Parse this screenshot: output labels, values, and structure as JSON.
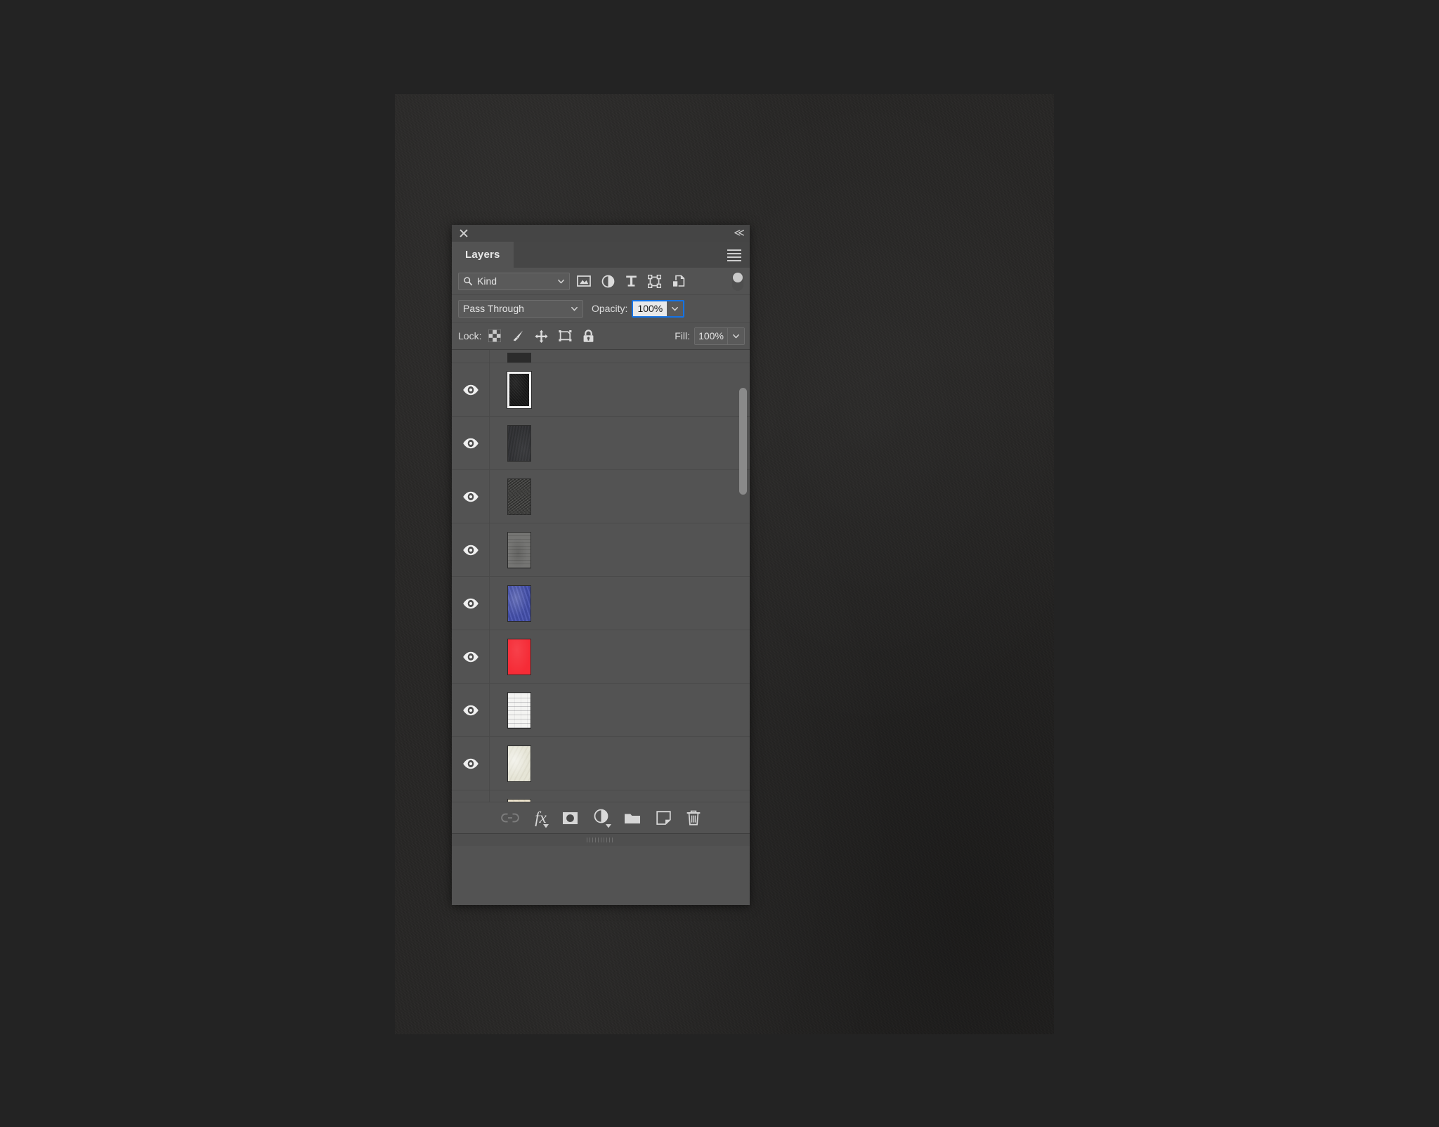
{
  "window": {
    "close_label": "×",
    "collapse_label": "«"
  },
  "panel": {
    "tab_label": "Layers",
    "menu_icon": "hamburger-menu-icon"
  },
  "filter_row": {
    "kind_label": "Kind",
    "search_icon": "search-icon",
    "dropdown_icon": "chevron-down-icon",
    "type_filters": [
      {
        "name": "filter-pixel-layers",
        "icon": "image-icon"
      },
      {
        "name": "filter-adjustment-layers",
        "icon": "adjustment-half-circle-icon"
      },
      {
        "name": "filter-type-layers",
        "icon": "text-t-icon"
      },
      {
        "name": "filter-shape-layers",
        "icon": "shape-vector-icon"
      },
      {
        "name": "filter-smart-objects",
        "icon": "smart-object-icon"
      }
    ],
    "toggle_name": "filter-enable-toggle"
  },
  "blend_row": {
    "blend_mode": "Pass Through",
    "opacity_label": "Opacity:",
    "opacity_value": "100%",
    "opacity_focused": true,
    "focus_color": "#1473e6"
  },
  "lock_row": {
    "lock_label": "Lock:",
    "lock_buttons": [
      {
        "name": "lock-transparent-pixels",
        "icon": "checkerboard-icon"
      },
      {
        "name": "lock-image-pixels",
        "icon": "brush-icon"
      },
      {
        "name": "lock-position",
        "icon": "move-arrows-icon"
      },
      {
        "name": "lock-artboard-nesting",
        "icon": "artboard-icon"
      },
      {
        "name": "lock-all",
        "icon": "padlock-icon"
      }
    ],
    "fill_label": "Fill:",
    "fill_value": "100%"
  },
  "layers": [
    {
      "name": "",
      "visible": false,
      "partial": true,
      "selected": false,
      "thumb": "dark-strip"
    },
    {
      "name": "",
      "visible": true,
      "partial": false,
      "selected": true,
      "thumb": "black-textured"
    },
    {
      "name": "",
      "visible": true,
      "partial": false,
      "selected": false,
      "thumb": "dark-charcoal"
    },
    {
      "name": "",
      "visible": true,
      "partial": false,
      "selected": false,
      "thumb": "dark-grunge"
    },
    {
      "name": "",
      "visible": true,
      "partial": false,
      "selected": false,
      "thumb": "gray-sketch"
    },
    {
      "name": "",
      "visible": true,
      "partial": false,
      "selected": false,
      "thumb": "blue-fabric"
    },
    {
      "name": "",
      "visible": true,
      "partial": false,
      "selected": false,
      "thumb": "red-solid"
    },
    {
      "name": "",
      "visible": true,
      "partial": false,
      "selected": false,
      "thumb": "white-paper-lines"
    },
    {
      "name": "",
      "visible": true,
      "partial": false,
      "selected": false,
      "thumb": "cream-paper"
    },
    {
      "name": "",
      "visible": true,
      "partial": false,
      "selected": false,
      "thumb": "aged-paper"
    }
  ],
  "thumb_colors": {
    "dark-strip": "#2b2b2b",
    "black-textured": "#191919",
    "dark-charcoal": "#2f3033",
    "dark-grunge": "#3a3a38",
    "gray-sketch": "#6e6e6c",
    "blue-fabric": "#4450ad",
    "red-solid": "#f62b36",
    "white-paper-lines": "#f4f4f2",
    "cream-paper": "#e6e5d7",
    "aged-paper": "#ece3cd"
  },
  "scrollbar": {
    "name": "layer-list-scrollbar"
  },
  "footer": {
    "buttons": [
      {
        "name": "link-layers-button",
        "icon": "chain-link-icon",
        "disabled": true,
        "label": ""
      },
      {
        "name": "layer-style-button",
        "icon": "fx-icon",
        "label": "fx",
        "has_menu": true
      },
      {
        "name": "add-layer-mask-button",
        "icon": "mask-circle-icon",
        "label": ""
      },
      {
        "name": "new-adjustment-layer-button",
        "icon": "adjustment-half-circle-icon",
        "label": "",
        "has_menu": true
      },
      {
        "name": "new-group-button",
        "icon": "folder-icon",
        "label": ""
      },
      {
        "name": "new-layer-button",
        "icon": "new-page-icon",
        "label": ""
      },
      {
        "name": "delete-layer-button",
        "icon": "trash-icon",
        "label": ""
      }
    ]
  },
  "theme": {
    "panel_bg": "#535353",
    "header_bg": "#464646",
    "field_bg": "#5a5a5a",
    "text": "#e4e4e4",
    "canvas_bg": "#262524",
    "app_bg": "#232323"
  }
}
